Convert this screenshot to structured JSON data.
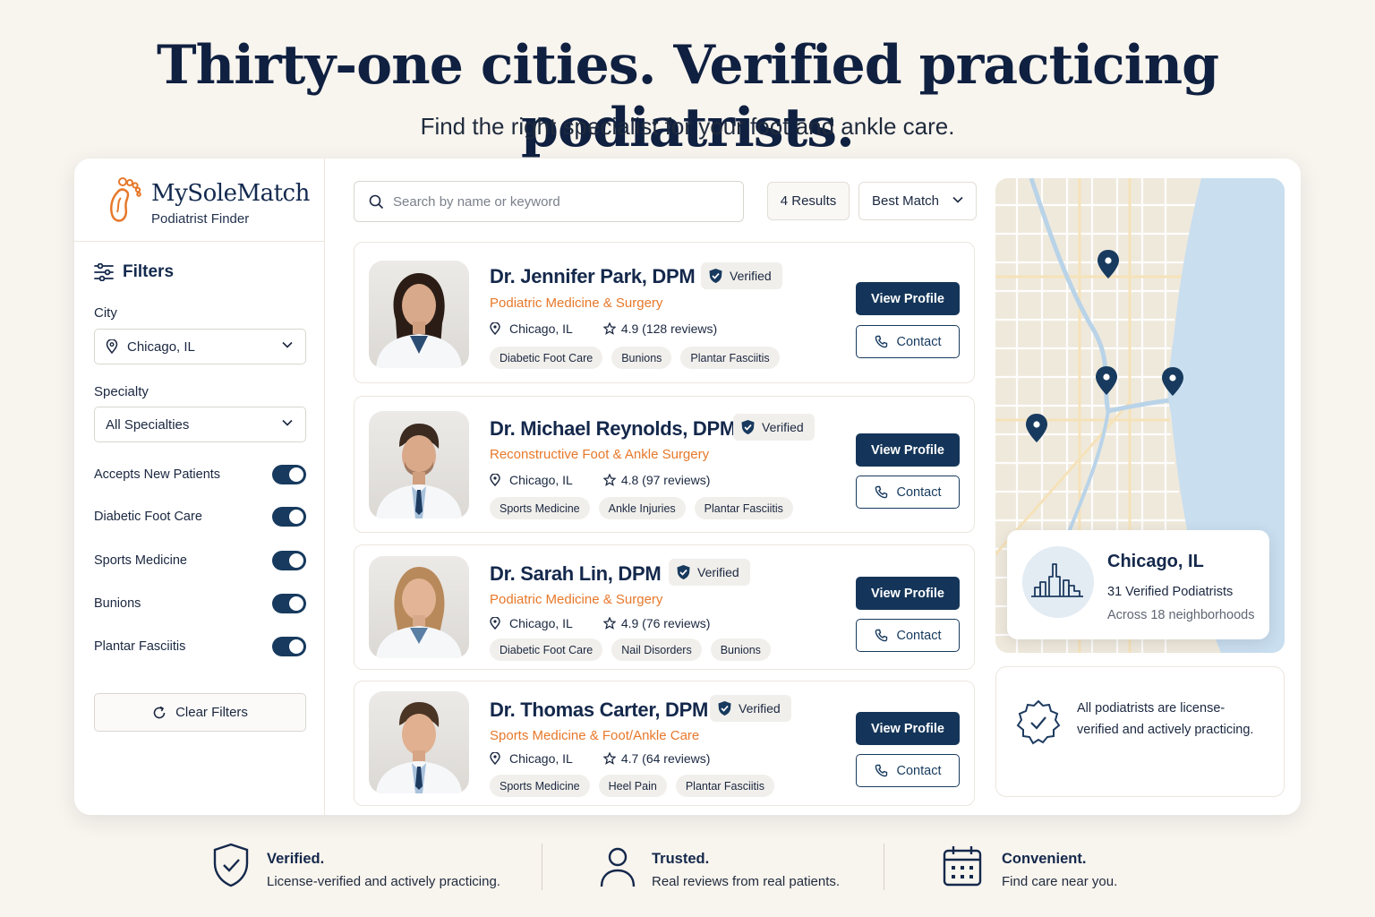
{
  "hero": {
    "title": "Thirty-one cities. Verified practicing podiatrists.",
    "subtitle": "Find the right specialist for your foot and ankle care."
  },
  "brand": {
    "name": "MySoleMatch",
    "tagline": "Podiatrist Finder",
    "logo_icon": "foot-icon",
    "accent": "#e7782a",
    "navy": "#143559"
  },
  "filters": {
    "heading": "Filters",
    "city_label": "City",
    "city_value": "Chicago, IL",
    "specialty_label": "Specialty",
    "specialty_value": "All Specialties",
    "toggles": [
      {
        "label": "Accepts New Patients",
        "on": true
      },
      {
        "label": "Diabetic Foot Care",
        "on": true
      },
      {
        "label": "Sports Medicine",
        "on": true
      },
      {
        "label": "Bunions",
        "on": true
      },
      {
        "label": "Plantar Fasciitis",
        "on": true
      }
    ],
    "clear_label": "Clear Filters"
  },
  "search": {
    "placeholder": "Search by name or keyword",
    "results": "4 Results",
    "sort": "Best Match"
  },
  "doctors": [
    {
      "name": "Dr. Jennifer Park, DPM",
      "verified": "Verified",
      "specialty": "Podiatric Medicine & Surgery",
      "location": "Chicago, IL",
      "rating": "4.9 (128 reviews)",
      "tags": [
        "Diabetic Foot Care",
        "Bunions",
        "Plantar Fasciitis"
      ],
      "view": "View Profile",
      "contact": "Contact"
    },
    {
      "name": "Dr. Michael Reynolds, DPM",
      "verified": "Verified",
      "specialty": "Reconstructive Foot & Ankle Surgery",
      "location": "Chicago, IL",
      "rating": "4.8 (97 reviews)",
      "tags": [
        "Sports Medicine",
        "Ankle Injuries",
        "Plantar Fasciitis"
      ],
      "view": "View Profile",
      "contact": "Contact"
    },
    {
      "name": "Dr. Sarah Lin, DPM",
      "verified": "Verified",
      "specialty": "Podiatric Medicine & Surgery",
      "location": "Chicago, IL",
      "rating": "4.9 (76 reviews)",
      "tags": [
        "Diabetic Foot Care",
        "Nail Disorders",
        "Bunions"
      ],
      "view": "View Profile",
      "contact": "Contact"
    },
    {
      "name": "Dr. Thomas Carter, DPM",
      "verified": "Verified",
      "specialty": "Sports Medicine & Foot/Ankle Care",
      "location": "Chicago, IL",
      "rating": "4.7 (64 reviews)",
      "tags": [
        "Sports Medicine",
        "Heel Pain",
        "Plantar Fasciitis"
      ],
      "view": "View Profile",
      "contact": "Contact"
    }
  ],
  "map": {
    "city": "Chicago, IL",
    "count": "31 Verified Podiatrists",
    "neighborhoods": "Across 18 neighborhoods",
    "city_icon": "skyline-icon",
    "pin_icon": "map-pin-icon",
    "water_color": "#c9deef",
    "land_color": "#efe9dc"
  },
  "license_note": "All podiatrists are license-verified and actively practicing.",
  "features": [
    {
      "title": "Verified.",
      "desc": "License-verified and actively practicing.",
      "icon": "shield-check-icon"
    },
    {
      "title": "Trusted.",
      "desc": "Real reviews from real patients.",
      "icon": "user-icon"
    },
    {
      "title": "Convenient.",
      "desc": "Find care near you.",
      "icon": "calendar-icon"
    }
  ]
}
